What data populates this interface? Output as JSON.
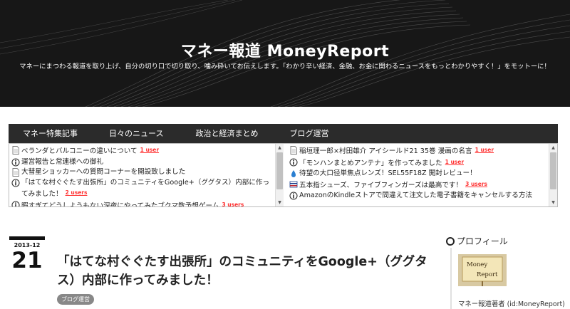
{
  "header": {
    "title": "マネー報道 MoneyReport",
    "description": "マネーにまつわる報道を取り上げ、自分の切り口で切り取り、噛み砕いてお伝えします。「わかり辛い経済、金融、お金に関わるニュースをもっとわかりやすく！」をモットーに！"
  },
  "nav": {
    "items": [
      {
        "label": "マネー特集記事"
      },
      {
        "label": "日々のニュース"
      },
      {
        "label": "政治と経済まとめ"
      },
      {
        "label": "ブログ運営"
      }
    ]
  },
  "feeds": {
    "left": [
      {
        "icon": "page-icon",
        "text": "ベランダとバルコニーの違いについて",
        "users": "1 user"
      },
      {
        "icon": "info-icon",
        "text": "運営報告と常連様への御礼",
        "users": ""
      },
      {
        "icon": "page-icon",
        "text": "大彗星ショッカーへの質問コーナーを開設致しました",
        "users": ""
      },
      {
        "icon": "info-icon",
        "text": "「はてな村ぐぐたす出張所」のコミュニティをGoogle+（ググタス）内部に作ってみました！",
        "users": "2 users"
      },
      {
        "icon": "info-icon",
        "text": "暇すぎてどうしようもない深夜にやってみたブクマ数予想ゲーム",
        "users": "3 users"
      }
    ],
    "right": [
      {
        "icon": "page-icon",
        "text": "稲垣理一郎×村田雄介 アイシールド21 35巻 漫画の名言",
        "users": "1 user"
      },
      {
        "icon": "info-icon",
        "text": "「モンハンまとめアンテナ」を作ってみました",
        "users": "1 user"
      },
      {
        "icon": "drop-icon",
        "text": "待望の大口径単焦点レンズ！SEL55F18Z 開封レビュー！",
        "users": ""
      },
      {
        "icon": "flag-icon",
        "text": "五本指シューズ、ファイブフィンガーズは最高です！",
        "users": "3 users"
      },
      {
        "icon": "info-icon",
        "text": "AmazonのKindleストアで間違えて注文した電子書籍をキャンセルする方法",
        "users": ""
      }
    ]
  },
  "article": {
    "year_month": "2013-12",
    "day": "21",
    "title": "「はてな村ぐぐたす出張所」のコミュニティをGoogle+（ググタス）内部に作ってみました！",
    "category": "ブログ運営"
  },
  "sidebar": {
    "profile_title": "プロフィール",
    "avatar_text_line1": "Money",
    "avatar_text_line2": "Report",
    "author": "マネー報道著者 (id:MoneyReport)"
  },
  "colors": {
    "header_bg": "#171717",
    "nav_bg": "#2b2b2b",
    "users_red": "#ff3333",
    "tag_bg": "#888888",
    "avatar_bg": "#d8c9a2"
  }
}
